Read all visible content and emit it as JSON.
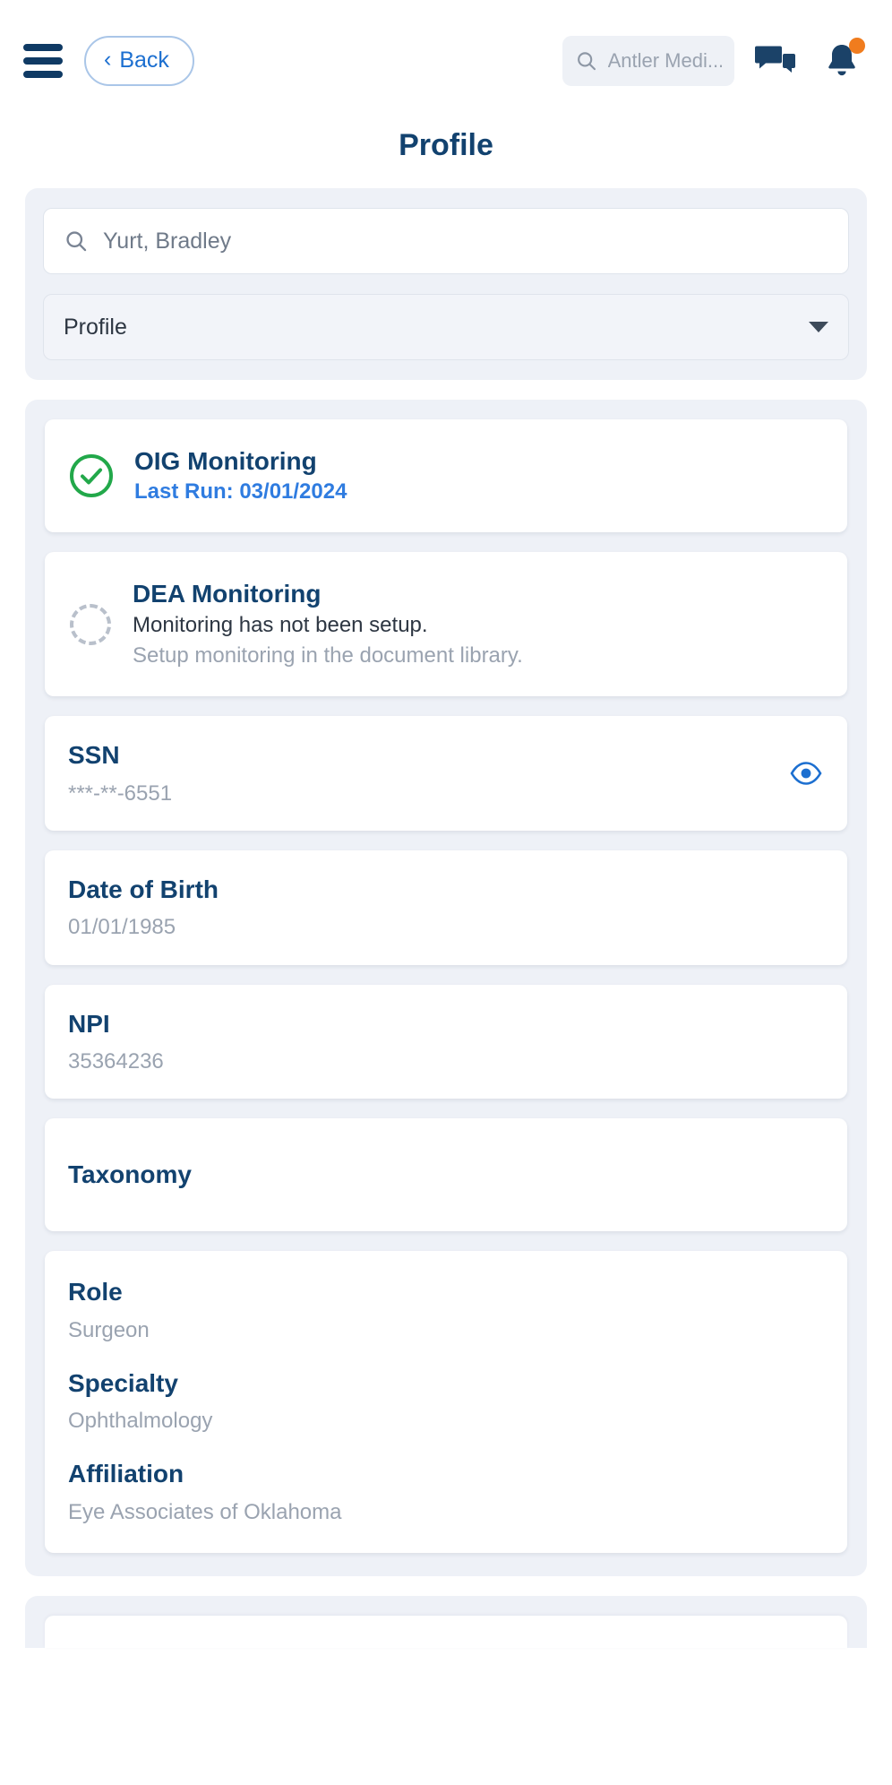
{
  "topbar": {
    "menu_icon": "hamburger-menu-icon",
    "back_label": "Back",
    "back_chevron": "‹",
    "search": {
      "icon": "search-icon",
      "placeholder": "Antler Medi...",
      "value": "Antler Medi..."
    },
    "chat_icon": "chat-bubbles-icon",
    "bell_icon": "notification-bell-icon",
    "bell_badge": true,
    "badge_color": "#f07c1e"
  },
  "page": {
    "title": "Profile"
  },
  "filters": {
    "search": {
      "icon": "search-icon",
      "value": "Yurt, Bradley",
      "placeholder": "Yurt, Bradley"
    },
    "select": {
      "value": "Profile",
      "options": [
        "Profile"
      ]
    }
  },
  "monitoring": [
    {
      "status_icon": "check-circle-icon",
      "status": "complete",
      "title": "OIG Monitoring",
      "subtitle_blue": "Last Run: 03/01/2024"
    },
    {
      "status_icon": "dashed-circle-icon",
      "status": "not-setup",
      "title": "DEA Monitoring",
      "subtitle_dark": "Monitoring has not been setup.",
      "subtitle_gray": "Setup monitoring in the document library."
    }
  ],
  "fields": [
    {
      "label": "SSN",
      "value": "***-**-6551",
      "action_icon": "eye-icon",
      "has_reveal": true
    },
    {
      "label": "Date of Birth",
      "value": "01/01/1985",
      "has_reveal": false
    },
    {
      "label": "NPI",
      "value": "35364236",
      "has_reveal": false
    },
    {
      "label": "Taxonomy",
      "value": "",
      "has_reveal": false
    }
  ],
  "details": [
    {
      "label": "Role",
      "value": "Surgeon"
    },
    {
      "label": "Specialty",
      "value": "Ophthalmology"
    },
    {
      "label": "Affiliation",
      "value": "Eye Associates of Oklahoma"
    }
  ],
  "colors": {
    "brand_navy": "#12426f",
    "link_blue": "#2f7ce0",
    "success_green": "#22a84a",
    "accent_orange": "#f07c1e",
    "muted_gray": "#9aa3b0",
    "panel_bg": "#eef1f7"
  }
}
